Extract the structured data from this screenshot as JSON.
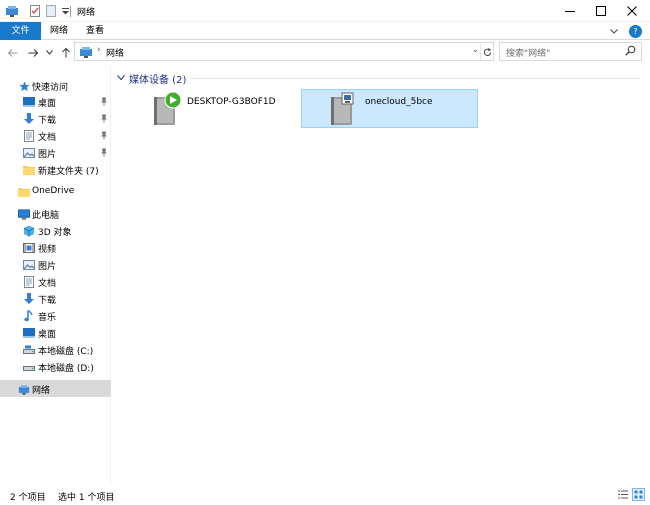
{
  "window": {
    "title": "网络",
    "minimize_glyph": "—",
    "maximize_glyph": "☐",
    "close_glyph": "✕"
  },
  "ribbon": {
    "tabs": [
      {
        "label": "文件"
      },
      {
        "label": "网络"
      },
      {
        "label": "查看"
      }
    ],
    "expand_glyph": "⌄",
    "help_glyph": "?"
  },
  "nav": {
    "back_glyph": "←",
    "forward_glyph": "→",
    "recent_glyph": "⌄",
    "up_glyph": "↑"
  },
  "address": {
    "crumb": "网络",
    "chevron": "›",
    "dropdown": "⌄"
  },
  "search": {
    "placeholder": "搜索\"网络\""
  },
  "sidebar": {
    "quick_access": "快速访问",
    "quick_items": [
      {
        "label": "桌面",
        "pinned": true
      },
      {
        "label": "下载",
        "pinned": true
      },
      {
        "label": "文档",
        "pinned": true
      },
      {
        "label": "图片",
        "pinned": true
      },
      {
        "label": "新建文件夹 (7)",
        "pinned": false
      }
    ],
    "onedrive": "OneDrive",
    "this_pc": "此电脑",
    "pc_items": [
      {
        "label": "3D 对象"
      },
      {
        "label": "视频"
      },
      {
        "label": "图片"
      },
      {
        "label": "文档"
      },
      {
        "label": "下载"
      },
      {
        "label": "音乐"
      },
      {
        "label": "桌面"
      },
      {
        "label": "本地磁盘 (C:)"
      },
      {
        "label": "本地磁盘 (D:)"
      }
    ],
    "network": "网络"
  },
  "content": {
    "group_title": "媒体设备 (2)",
    "devices": [
      {
        "name": "DESKTOP-G3BOF1D",
        "selected": false
      },
      {
        "name": "onecloud_5bce",
        "selected": true
      }
    ]
  },
  "status": {
    "item_count": "2 个项目",
    "selected_count": "选中 1 个项目"
  },
  "colors": {
    "accent": "#1979ca",
    "selection": "#cce8ff",
    "group_title": "#1e3287"
  }
}
